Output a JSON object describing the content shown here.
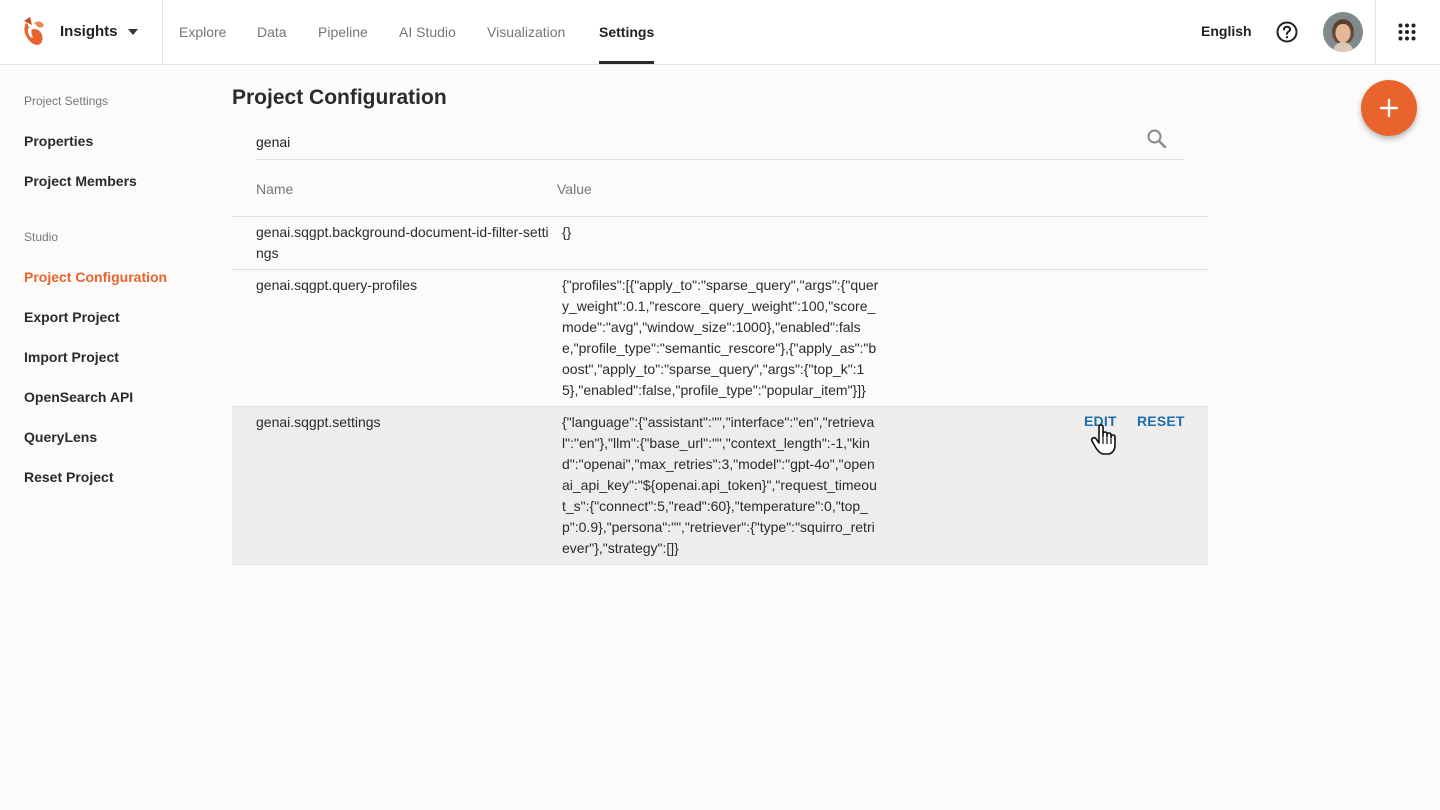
{
  "header": {
    "project_name": "Insights",
    "tabs": [
      {
        "label": "Explore"
      },
      {
        "label": "Data"
      },
      {
        "label": "Pipeline"
      },
      {
        "label": "AI Studio"
      },
      {
        "label": "Visualization"
      },
      {
        "label": "Settings",
        "active": true
      }
    ],
    "language": "English",
    "icons": {
      "help": "help-circle-icon",
      "apps": "apps-grid-icon",
      "logo": "squirrel-logo-icon"
    },
    "brand_color": "#e8642c"
  },
  "sidebar": {
    "sections": [
      {
        "title": "Project Settings",
        "items": [
          {
            "label": "Properties"
          },
          {
            "label": "Project Members"
          }
        ]
      },
      {
        "title": "Studio",
        "items": [
          {
            "label": "Project Configuration",
            "active": true
          },
          {
            "label": "Export Project"
          },
          {
            "label": "Import Project"
          },
          {
            "label": "OpenSearch API"
          },
          {
            "label": "QueryLens"
          },
          {
            "label": "Reset Project"
          }
        ]
      }
    ]
  },
  "main": {
    "title": "Project Configuration",
    "search": {
      "value": "genai"
    },
    "columns": {
      "name": "Name",
      "value": "Value"
    },
    "rows": [
      {
        "name": "genai.sqgpt.background-document-id-filter-settings",
        "value": "{}"
      },
      {
        "name": "genai.sqgpt.query-profiles",
        "value": "{\"profiles\":[{\"apply_to\":\"sparse_query\",\"args\":{\"query_weight\":0.1,\"rescore_query_weight\":100,\"score_mode\":\"avg\",\"window_size\":1000},\"enabled\":false,\"profile_type\":\"semantic_rescore\"},{\"apply_as\":\"boost\",\"apply_to\":\"sparse_query\",\"args\":{\"top_k\":15},\"enabled\":false,\"profile_type\":\"popular_item\"}]}"
      },
      {
        "name": "genai.sqgpt.settings",
        "value": "{\"language\":{\"assistant\":\"\",\"interface\":\"en\",\"retrieval\":\"en\"},\"llm\":{\"base_url\":\"\",\"context_length\":-1,\"kind\":\"openai\",\"max_retries\":3,\"model\":\"gpt-4o\",\"openai_api_key\":\"${openai.api_token}\",\"request_timeout_s\":{\"connect\":5,\"read\":60},\"temperature\":0,\"top_p\":0.9},\"persona\":\"\",\"retriever\":{\"type\":\"squirro_retriever\"},\"strategy\":[]}",
        "hovered": true
      }
    ],
    "row_actions": {
      "edit": "EDIT",
      "reset": "RESET"
    },
    "action_color": "#1d6fae"
  },
  "fab": {
    "icon": "plus-icon"
  }
}
